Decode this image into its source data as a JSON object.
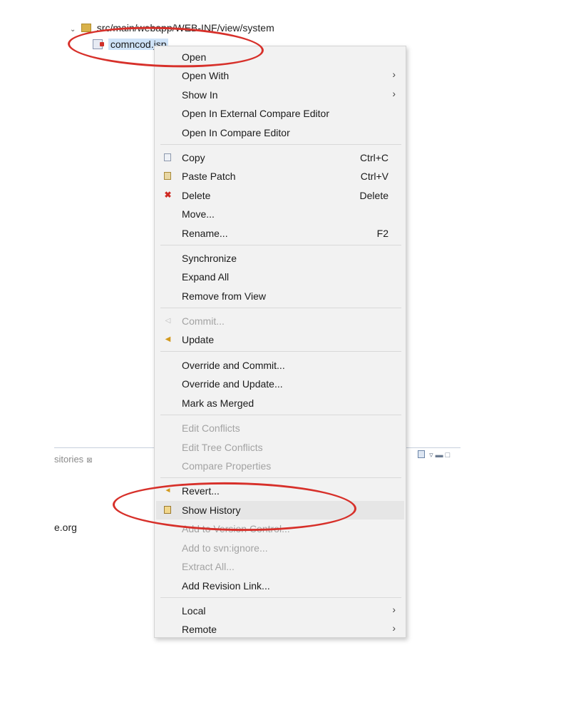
{
  "tree": {
    "folder_path": "src/main/webapp/WEB-INF/view/system",
    "file_name": "comncod.jsp"
  },
  "view": {
    "tab_label": "sitories",
    "text": "e.org"
  },
  "menu": {
    "items": [
      {
        "label": "Open",
        "shortcut": "",
        "submenu": false,
        "enabled": true,
        "icon": ""
      },
      {
        "label": "Open With",
        "shortcut": "",
        "submenu": true,
        "enabled": true,
        "icon": ""
      },
      {
        "label": "Show In",
        "shortcut": "",
        "submenu": true,
        "enabled": true,
        "icon": ""
      },
      {
        "label": "Open In External Compare Editor",
        "shortcut": "",
        "submenu": false,
        "enabled": true,
        "icon": ""
      },
      {
        "label": "Open In Compare Editor",
        "shortcut": "",
        "submenu": false,
        "enabled": true,
        "icon": ""
      },
      {
        "label": "Copy",
        "shortcut": "Ctrl+C",
        "submenu": false,
        "enabled": true,
        "icon": "copy-icon"
      },
      {
        "label": "Paste Patch",
        "shortcut": "Ctrl+V",
        "submenu": false,
        "enabled": true,
        "icon": "paste-icon"
      },
      {
        "label": "Delete",
        "shortcut": "Delete",
        "submenu": false,
        "enabled": true,
        "icon": "delete-icon"
      },
      {
        "label": "Move...",
        "shortcut": "",
        "submenu": false,
        "enabled": true,
        "icon": ""
      },
      {
        "label": "Rename...",
        "shortcut": "F2",
        "submenu": false,
        "enabled": true,
        "icon": ""
      },
      {
        "label": "Synchronize",
        "shortcut": "",
        "submenu": false,
        "enabled": true,
        "icon": ""
      },
      {
        "label": "Expand All",
        "shortcut": "",
        "submenu": false,
        "enabled": true,
        "icon": ""
      },
      {
        "label": "Remove from View",
        "shortcut": "",
        "submenu": false,
        "enabled": true,
        "icon": ""
      },
      {
        "label": "Commit...",
        "shortcut": "",
        "submenu": false,
        "enabled": false,
        "icon": "commit-icon"
      },
      {
        "label": "Update",
        "shortcut": "",
        "submenu": false,
        "enabled": true,
        "icon": "update-icon"
      },
      {
        "label": "Override and Commit...",
        "shortcut": "",
        "submenu": false,
        "enabled": true,
        "icon": ""
      },
      {
        "label": "Override and Update...",
        "shortcut": "",
        "submenu": false,
        "enabled": true,
        "icon": ""
      },
      {
        "label": "Mark as Merged",
        "shortcut": "",
        "submenu": false,
        "enabled": true,
        "icon": ""
      },
      {
        "label": "Edit Conflicts",
        "shortcut": "",
        "submenu": false,
        "enabled": false,
        "icon": ""
      },
      {
        "label": "Edit Tree Conflicts",
        "shortcut": "",
        "submenu": false,
        "enabled": false,
        "icon": ""
      },
      {
        "label": "Compare Properties",
        "shortcut": "",
        "submenu": false,
        "enabled": false,
        "icon": ""
      },
      {
        "label": "Revert...",
        "shortcut": "",
        "submenu": false,
        "enabled": true,
        "icon": "revert-icon"
      },
      {
        "label": "Show History",
        "shortcut": "",
        "submenu": false,
        "enabled": true,
        "icon": "history-icon",
        "highlighted": true
      },
      {
        "label": "Add to Version Control...",
        "shortcut": "",
        "submenu": false,
        "enabled": false,
        "icon": ""
      },
      {
        "label": "Add to svn:ignore...",
        "shortcut": "",
        "submenu": false,
        "enabled": false,
        "icon": ""
      },
      {
        "label": "Extract All...",
        "shortcut": "",
        "submenu": false,
        "enabled": false,
        "icon": ""
      },
      {
        "label": "Add Revision Link...",
        "shortcut": "",
        "submenu": false,
        "enabled": true,
        "icon": ""
      },
      {
        "label": "Local",
        "shortcut": "",
        "submenu": true,
        "enabled": true,
        "icon": ""
      },
      {
        "label": "Remote",
        "shortcut": "",
        "submenu": true,
        "enabled": true,
        "icon": ""
      }
    ]
  },
  "colors": {
    "annotation": "#d7302a",
    "menu_background": "#f2f2f2",
    "disabled_text": "#a3a3a3"
  }
}
